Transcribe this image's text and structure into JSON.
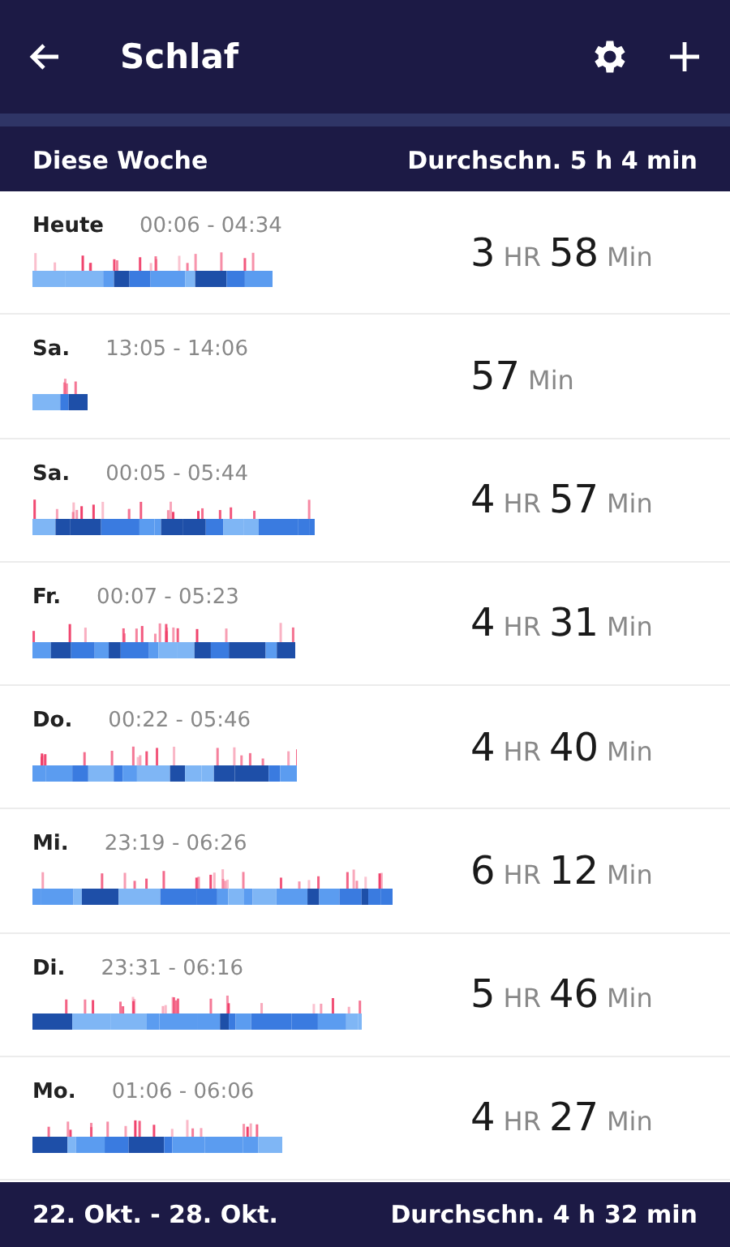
{
  "app_bar": {
    "title": "Schlaf"
  },
  "week_header": {
    "label": "Diese Woche",
    "average": "Durchschn. 5 h 4 min"
  },
  "nights": [
    {
      "day": "Heute",
      "time": "00:06 - 04:34",
      "duration": [
        {
          "value": "3",
          "unit": "HR"
        },
        {
          "value": "58",
          "unit": "Min"
        }
      ]
    },
    {
      "day": "Sa.",
      "time": "13:05 - 14:06",
      "duration": [
        {
          "value": "57",
          "unit": "Min"
        }
      ]
    },
    {
      "day": "Sa.",
      "time": "00:05 - 05:44",
      "duration": [
        {
          "value": "4",
          "unit": "HR"
        },
        {
          "value": "57",
          "unit": "Min"
        }
      ]
    },
    {
      "day": "Fr.",
      "time": "00:07 - 05:23",
      "duration": [
        {
          "value": "4",
          "unit": "HR"
        },
        {
          "value": "31",
          "unit": "Min"
        }
      ]
    },
    {
      "day": "Do.",
      "time": "00:22 - 05:46",
      "duration": [
        {
          "value": "4",
          "unit": "HR"
        },
        {
          "value": "40",
          "unit": "Min"
        }
      ]
    },
    {
      "day": "Mi.",
      "time": "23:19 - 06:26",
      "duration": [
        {
          "value": "6",
          "unit": "HR"
        },
        {
          "value": "12",
          "unit": "Min"
        }
      ]
    },
    {
      "day": "Di.",
      "time": "23:31 - 06:16",
      "duration": [
        {
          "value": "5",
          "unit": "HR"
        },
        {
          "value": "46",
          "unit": "Min"
        }
      ]
    },
    {
      "day": "Mo.",
      "time": "01:06 - 06:06",
      "duration": [
        {
          "value": "4",
          "unit": "HR"
        },
        {
          "value": "27",
          "unit": "Min"
        }
      ]
    }
  ],
  "week_footer": {
    "label": "22. Okt. - 28. Okt.",
    "average": "Durchschn. 4 h 32 min"
  }
}
